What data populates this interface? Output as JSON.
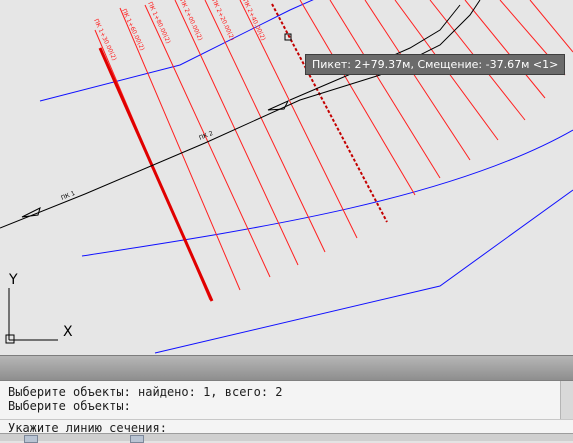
{
  "tooltip": {
    "text": "Пикет: 2+79.37м, Смещение: -37.67м <1>"
  },
  "ucs": {
    "x_label": "X",
    "y_label": "Y"
  },
  "section_labels": [
    "ПК 1+30.00(2)",
    "ПК 1+60.00(2)",
    "ПК 1+80.00(2)",
    "ПК 2+00.00(2)",
    "ПК 2+20.00(2)",
    "ПК 2+40.00(2)"
  ],
  "alignment_labels": [
    "ПК 1",
    "ПК 2",
    "ПК 3"
  ],
  "command_line": {
    "history": [
      "Выберите объекты: найдено: 1, всего: 2",
      "Выберите объекты:"
    ],
    "prompt": "Укажите линию сечения:"
  },
  "colors": {
    "section_red": "#ff1a1a",
    "alignment_black": "#000000",
    "offset_blue": "#0000ff",
    "background": "#e6e6e6"
  }
}
